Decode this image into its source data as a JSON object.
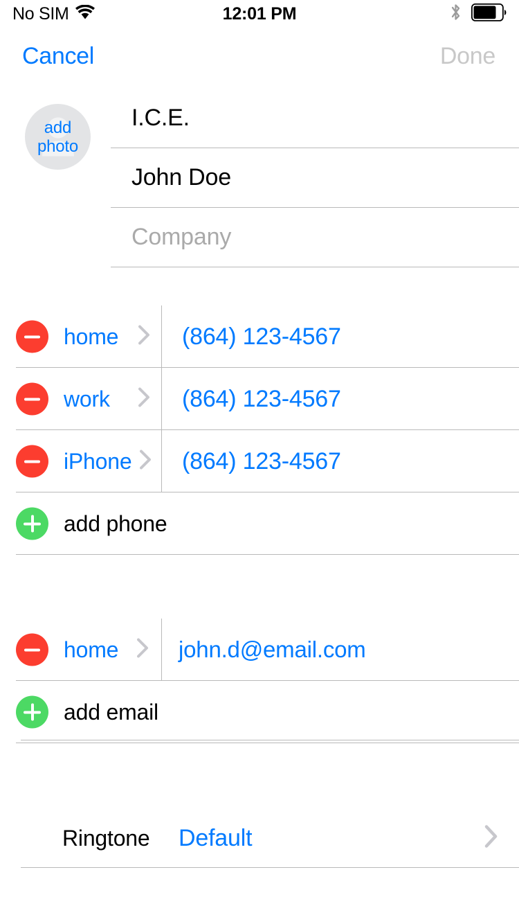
{
  "status_bar": {
    "carrier": "No SIM",
    "wifi_icon": "wifi-icon",
    "time": "12:01 PM",
    "bluetooth_icon": "bluetooth-icon",
    "battery_icon": "battery-icon",
    "battery_level_percent": 78
  },
  "nav_bar": {
    "cancel_label": "Cancel",
    "done_label": "Done",
    "done_enabled": false
  },
  "avatar": {
    "label_line1": "add",
    "label_line2": "photo"
  },
  "name_fields": [
    {
      "name": "first-name-field",
      "value": "I.C.E.",
      "is_placeholder": false
    },
    {
      "name": "last-name-field",
      "value": "John Doe",
      "is_placeholder": false
    },
    {
      "name": "company-field",
      "value": "Company",
      "is_placeholder": true
    }
  ],
  "phone_section": {
    "rows": [
      {
        "label": "home",
        "value": "(864) 123-4567"
      },
      {
        "label": "work",
        "value": "(864) 123-4567"
      },
      {
        "label": "iPhone",
        "value": "(864) 123-4567"
      }
    ],
    "add_label": "add phone"
  },
  "email_section": {
    "rows": [
      {
        "label": "home",
        "value": "john.d@email.com"
      }
    ],
    "add_label": "add email"
  },
  "ringtone": {
    "label": "Ringtone",
    "value": "Default"
  },
  "colors": {
    "accent_blue": "#007aff",
    "delete_red": "#fc3d2f",
    "add_green": "#4cd964",
    "separator": "#b9b9b9",
    "placeholder_gray": "#aaaaaa",
    "disabled_gray": "#c8c8c8",
    "chevron_gray": "#c7c7cc",
    "avatar_bg": "#e3e4e6"
  }
}
